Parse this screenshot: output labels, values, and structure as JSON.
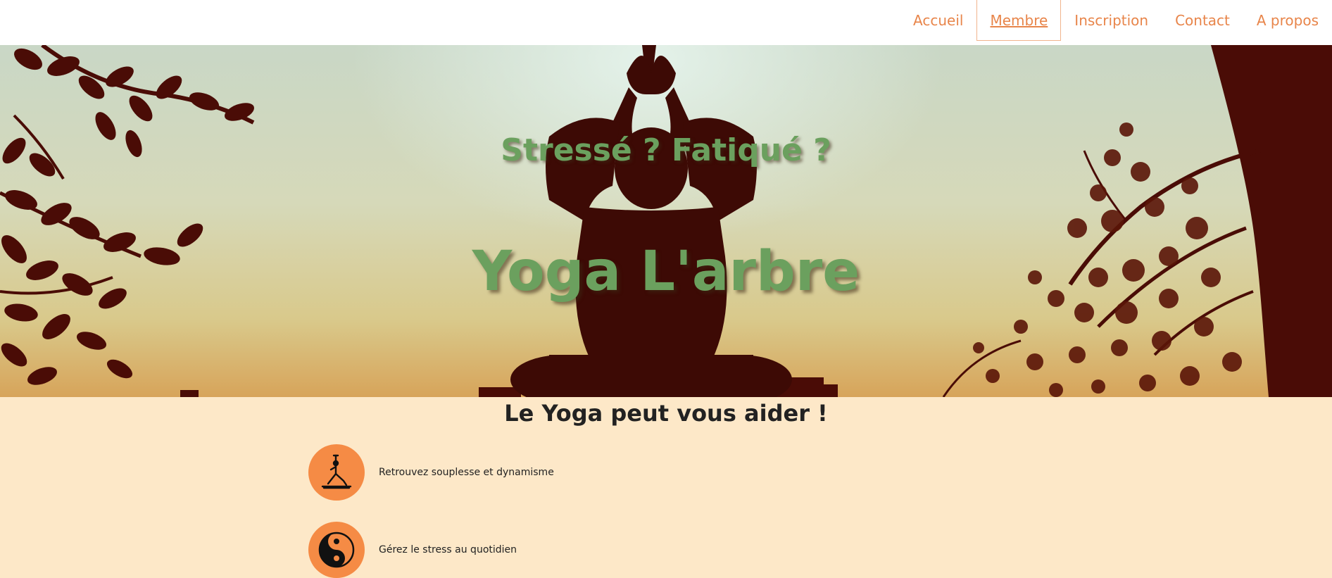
{
  "nav": {
    "items": [
      {
        "label": "Accueil"
      },
      {
        "label": "Membre"
      },
      {
        "label": "Inscription"
      },
      {
        "label": "Contact"
      },
      {
        "label": "A propos"
      }
    ],
    "active": "Membre",
    "accent_color": "#e8854a"
  },
  "hero": {
    "subtitle": "Stressé ? Fatiqué ?",
    "title": "Yoga L'arbre",
    "title_color": "#6ba05e"
  },
  "benefits": {
    "heading": "Le Yoga peut vous aider !",
    "items": [
      {
        "icon": "yoga-pose-icon",
        "text": "Retrouvez souplesse et dynamisme"
      },
      {
        "icon": "yin-yang-icon",
        "text": "Gérez le stress au quotidien"
      }
    ],
    "circle_color": "#f58b45",
    "background": "#fde8c8"
  }
}
